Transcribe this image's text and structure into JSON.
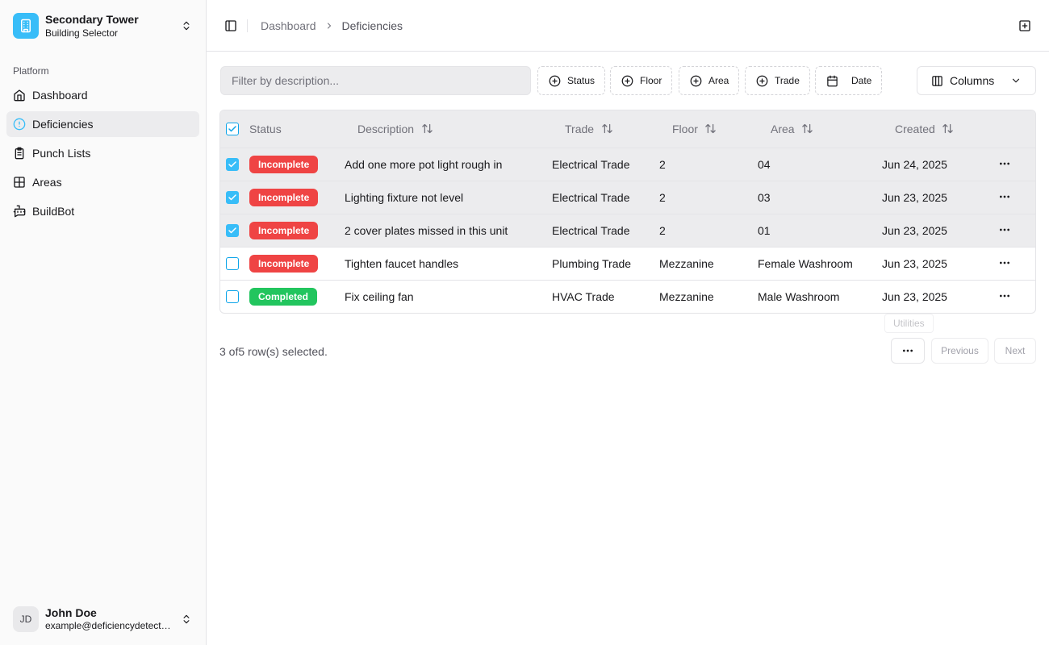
{
  "building": {
    "name": "Secondary Tower",
    "subtitle": "Building Selector"
  },
  "sidebar": {
    "group_label": "Platform",
    "items": [
      {
        "label": "Dashboard",
        "icon": "home-icon",
        "active": false
      },
      {
        "label": "Deficiencies",
        "icon": "alert-circle-icon",
        "active": true
      },
      {
        "label": "Punch Lists",
        "icon": "clipboard-icon",
        "active": false
      },
      {
        "label": "Areas",
        "icon": "layout-grid-icon",
        "active": false
      },
      {
        "label": "BuildBot",
        "icon": "bot-message-icon",
        "active": false
      }
    ]
  },
  "user": {
    "initials": "JD",
    "name": "John Doe",
    "email": "example@deficiencydetect...."
  },
  "breadcrumb": {
    "root": "Dashboard",
    "current": "Deficiencies"
  },
  "filters": {
    "placeholder": "Filter by description...",
    "status": "Status",
    "floor": "Floor",
    "area": "Area",
    "trade": "Trade",
    "date": "Date",
    "columns": "Columns"
  },
  "table": {
    "headers": {
      "status": "Status",
      "description": "Description",
      "trade": "Trade",
      "floor": "Floor",
      "area": "Area",
      "created": "Created"
    },
    "rows": [
      {
        "selected": true,
        "status": "Incomplete",
        "description": "Add one more pot light rough in",
        "trade": "Electrical Trade",
        "floor": "2",
        "area": "04",
        "created": "Jun 24, 2025"
      },
      {
        "selected": true,
        "status": "Incomplete",
        "description": "Lighting fixture not level",
        "trade": "Electrical Trade",
        "floor": "2",
        "area": "03",
        "created": "Jun 23, 2025"
      },
      {
        "selected": true,
        "status": "Incomplete",
        "description": "2 cover plates missed in this unit",
        "trade": "Electrical Trade",
        "floor": "2",
        "area": "01",
        "created": "Jun 23, 2025"
      },
      {
        "selected": false,
        "status": "Incomplete",
        "description": "Tighten faucet handles",
        "trade": "Plumbing Trade",
        "floor": "Mezzanine",
        "area": "Female Washroom",
        "created": "Jun 23, 2025"
      },
      {
        "selected": false,
        "status": "Completed",
        "description": "Fix ceiling fan",
        "trade": "HVAC Trade",
        "floor": "Mezzanine",
        "area": "Male Washroom",
        "created": "Jun 23, 2025"
      }
    ]
  },
  "footer": {
    "selection_text": "3 of5 row(s) selected.",
    "tooltip": "Utilities",
    "previous": "Previous",
    "next": "Next"
  },
  "colors": {
    "accent": "#38bdf8",
    "incomplete": "#ef4444",
    "completed": "#22c55e",
    "selected_row": "#ececee"
  }
}
